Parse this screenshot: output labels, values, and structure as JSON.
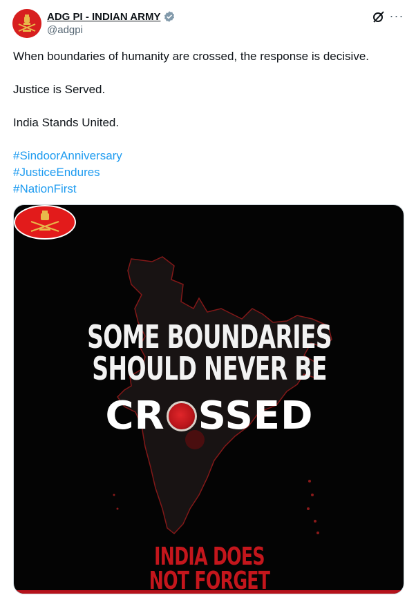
{
  "author": {
    "display_name": "ADG PI - INDIAN ARMY",
    "handle": "@adgpi",
    "avatar_icon": "indian-army-emblem-icon",
    "verified_icon": "verified-badge-icon",
    "verified_color": "#829aab"
  },
  "actions": {
    "grok_icon": "grok-icon",
    "more_icon": "more-options-icon",
    "more_label": "···"
  },
  "tweet": {
    "lines": [
      "When boundaries of humanity are crossed, the response is decisive.",
      "Justice is Served.",
      "India Stands United."
    ],
    "hashtags": [
      "#SindoorAnniversary",
      "#JusticeEndures",
      "#NationFirst"
    ],
    "hashtag_color": "#1d9bf0"
  },
  "media": {
    "headline_line1": "SOME BOUNDARIES",
    "headline_line2": "SHOULD NEVER BE",
    "crossed_prefix": "CR",
    "crossed_suffix": "SSED",
    "footer_line1": "INDIA DOES",
    "footer_line2": "NOT FORGET",
    "logo_icon": "indian-army-logo-icon",
    "map_icon": "india-map-outline-icon",
    "sindoor_icon": "sindoor-bowl-icon",
    "accent_color": "#c4161c",
    "background_color": "#040404"
  }
}
